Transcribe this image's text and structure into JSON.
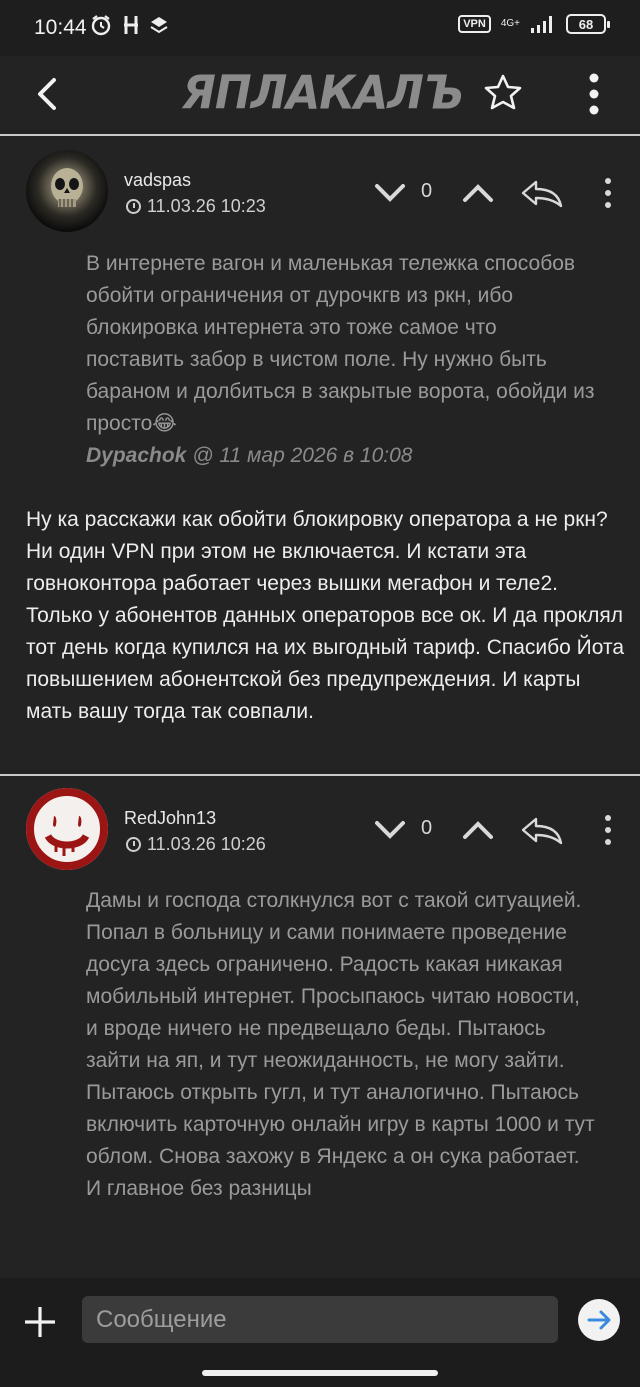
{
  "status_bar": {
    "time": "10:44",
    "vpn_label": "VPN",
    "network_label": "4G+",
    "battery": "68"
  },
  "header": {
    "logo_text": "ЯПЛАКАЛЪ"
  },
  "posts": [
    {
      "author": "vadspas",
      "datetime": "11.03.26 10:23",
      "votes": "0",
      "quote_text": "В интернете вагон и маленькая тележка способов обойти ограничения от дурочкгв из ркн, ибо блокировка интернета это тоже самое что поставить забор в чистом поле. Ну нужно быть бараном и долбиться в закрытые ворота, обойди из просто😂",
      "quote_author": "Dypachok",
      "quote_meta": " @ 11 мар 2026 в 10:08",
      "text": "Ну ка расскажи как обойти блокировку оператора а не ркн? Ни один VPN при этом не включается. И кстати эта говноконтора работает через вышки мегафон и теле2. Только у абонентов данных операторов все ок. И да проклял тот день когда купился на их выгодный тариф. Спасибо Йота повышением абонентской без предупреждения. И карты мать вашу тогда так совпали."
    },
    {
      "author": "RedJohn13",
      "datetime": "11.03.26 10:26",
      "votes": "0",
      "quote_text": "Дамы и господа столкнулся вот с такой ситуацией. Попал в больницу и сами понимаете проведение досуга здесь ограничено. Радость какая никакая мобильный интернет. Просыпаюсь читаю новости, и вроде ничего не предвещало беды. Пытаюсь зайти на яп, и тут неожиданность, не могу зайти. Пытаюсь открыть гугл, и тут аналогично. Пытаюсь включить карточную онлайн игру в карты 1000 и тут облом. Снова захожу в Яндекс а он сука работает. И главное без разницы"
    }
  ],
  "composer": {
    "placeholder": "Сообщение"
  }
}
